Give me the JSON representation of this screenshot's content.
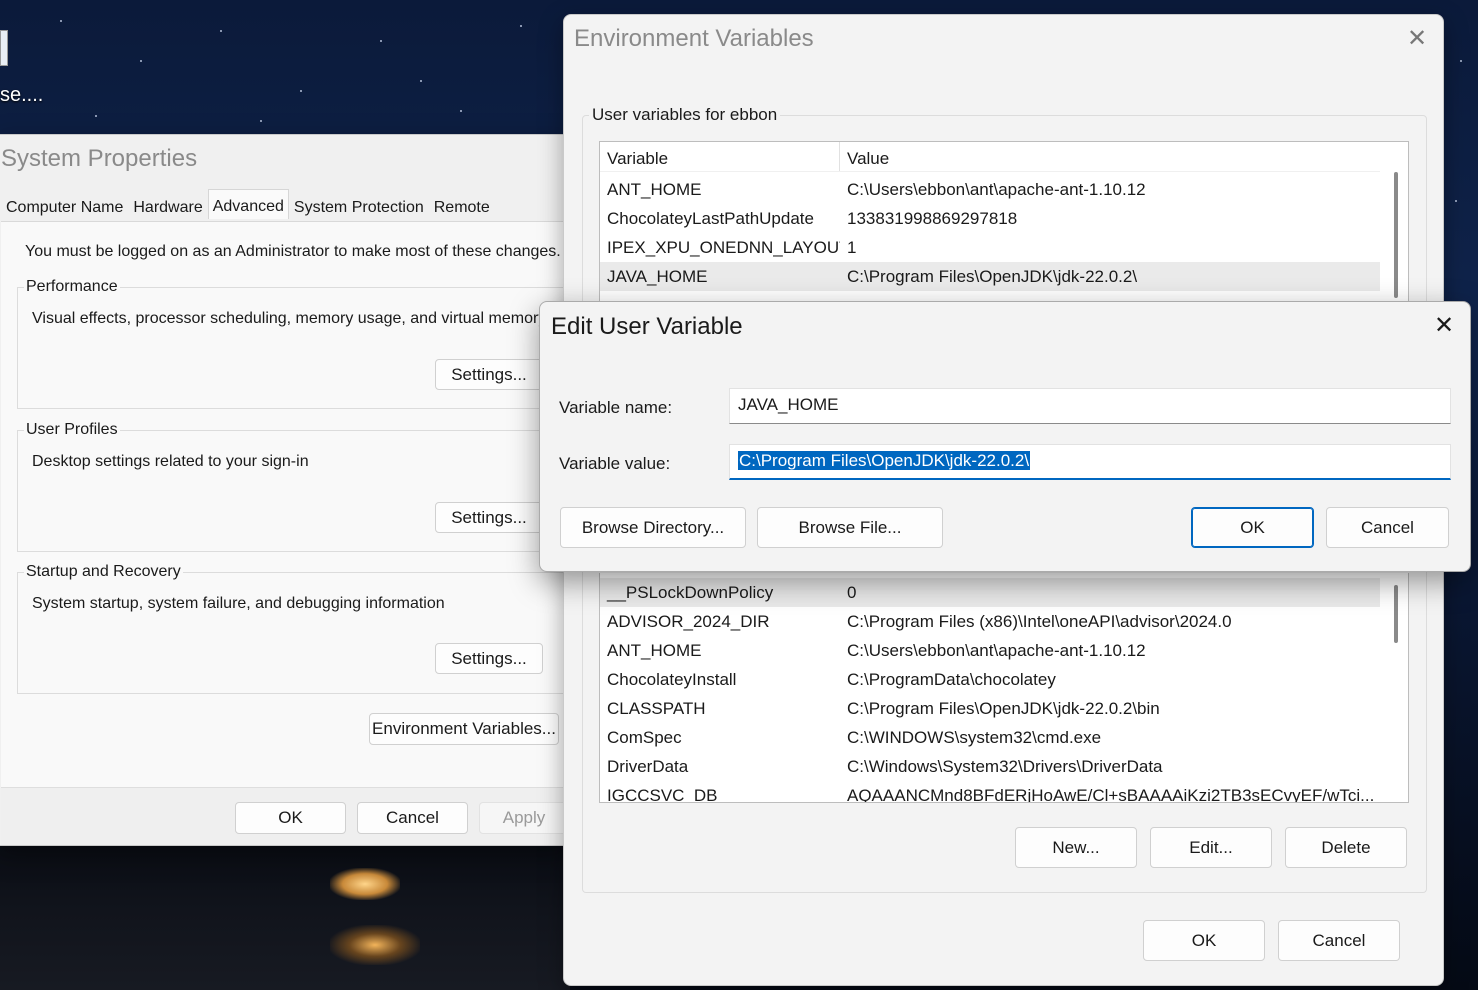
{
  "desktop": {
    "icon_label": "se...."
  },
  "system_properties": {
    "title": "System Properties",
    "tabs": [
      "Computer Name",
      "Hardware",
      "Advanced",
      "System Protection",
      "Remote"
    ],
    "active_tab": "Advanced",
    "notice": "You must be logged on as an Administrator to make most of these changes.",
    "performance": {
      "label": "Performance",
      "desc": "Visual effects, processor scheduling, memory usage, and virtual memory",
      "button": "Settings..."
    },
    "user_profiles": {
      "label": "User Profiles",
      "desc": "Desktop settings related to your sign-in",
      "button": "Settings..."
    },
    "startup_recovery": {
      "label": "Startup and Recovery",
      "desc": "System startup, system failure, and debugging information",
      "button": "Settings..."
    },
    "env_button": "Environment Variables...",
    "ok": "OK",
    "cancel": "Cancel",
    "apply": "Apply"
  },
  "env_vars": {
    "title": "Environment Variables",
    "close": "✕",
    "user_group_label": "User variables for ebbon",
    "columns": [
      "Variable",
      "Value"
    ],
    "user_rows": [
      {
        "name": "ANT_HOME",
        "value": "C:\\Users\\ebbon\\ant\\apache-ant-1.10.12"
      },
      {
        "name": "ChocolateyLastPathUpdate",
        "value": "133831998869297818"
      },
      {
        "name": "IPEX_XPU_ONEDNN_LAYOUT",
        "value": "1"
      },
      {
        "name": "JAVA_HOME",
        "value": "C:\\Program Files\\OpenJDK\\jdk-22.0.2\\"
      }
    ],
    "system_rows": [
      {
        "name": "__PSLockDownPolicy",
        "value": "0"
      },
      {
        "name": "ADVISOR_2024_DIR",
        "value": "C:\\Program Files (x86)\\Intel\\oneAPI\\advisor\\2024.0"
      },
      {
        "name": "ANT_HOME",
        "value": "C:\\Users\\ebbon\\ant\\apache-ant-1.10.12"
      },
      {
        "name": "ChocolateyInstall",
        "value": "C:\\ProgramData\\chocolatey"
      },
      {
        "name": "CLASSPATH",
        "value": "C:\\Program Files\\OpenJDK\\jdk-22.0.2\\bin"
      },
      {
        "name": "ComSpec",
        "value": "C:\\WINDOWS\\system32\\cmd.exe"
      },
      {
        "name": "DriverData",
        "value": "C:\\Windows\\System32\\Drivers\\DriverData"
      },
      {
        "name": "IGCCSVC_DB",
        "value": "AQAAANCMnd8BFdERjHoAwE/Cl+sBAAAAiKzi2TB3sECvyEF/wTci..."
      }
    ],
    "system_buttons": {
      "new": "New...",
      "edit": "Edit...",
      "delete": "Delete"
    },
    "ok": "OK",
    "cancel": "Cancel"
  },
  "edit_var": {
    "title": "Edit User Variable",
    "close": "✕",
    "name_label": "Variable name:",
    "name_value": "JAVA_HOME",
    "value_label": "Variable value:",
    "value_value": "C:\\Program Files\\OpenJDK\\jdk-22.0.2\\",
    "browse_dir": "Browse Directory...",
    "browse_file": "Browse File...",
    "ok": "OK",
    "cancel": "Cancel"
  }
}
